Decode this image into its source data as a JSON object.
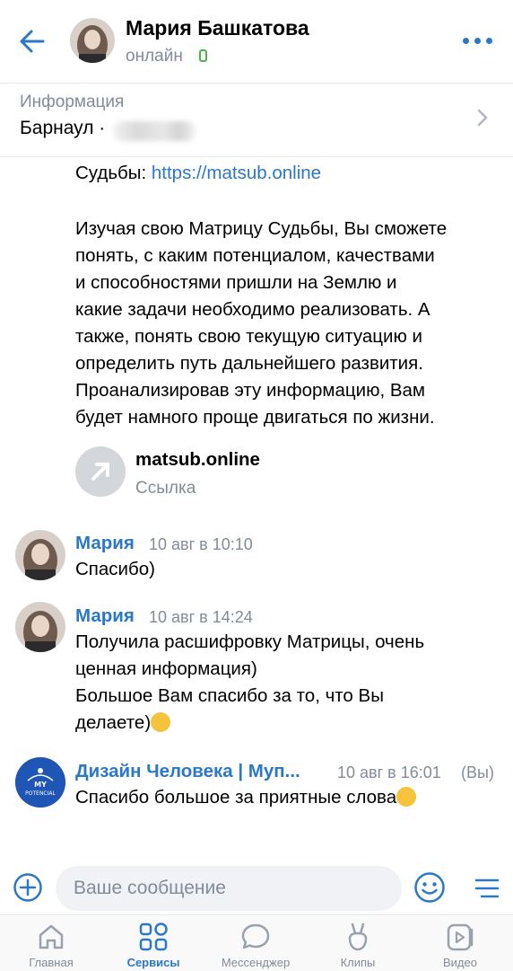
{
  "header": {
    "name": "Мария Башкатова",
    "status": "онлайн",
    "back_icon": "arrow-left-icon",
    "more_icon": "more-horizontal-icon"
  },
  "info": {
    "label": "Информация",
    "city": "Барнаул ·"
  },
  "message_top": {
    "line1_prefix": "Судьбы: ",
    "line1_link": "https://matsub.online",
    "paragraph": [
      "Изучая свою Матрицу Судьбы, Вы сможете",
      "понять, с каким потенциалом, качествами",
      "и способностями пришли на Землю и",
      "какие задачи необходимо реализовать. А",
      "также, понять свою текущую ситуацию и",
      "определить путь дальнейшего развития.",
      "Проанализировав эту информацию, Вам",
      "будет намного проще двигаться по жизни."
    ],
    "link_card": {
      "title": "matsub.online",
      "subtitle": "Ссылка"
    }
  },
  "messages": [
    {
      "sender": "Мария",
      "time": "10 авг в 10:10",
      "lines": [
        "Спасибо)"
      ]
    },
    {
      "sender": "Мария",
      "time": "10 авг в 14:24",
      "lines": [
        "Получила расшифровку Матрицы, очень",
        "ценная информация)",
        "Большое Вам спасибо за то, что Вы",
        "делаете)"
      ]
    },
    {
      "sender": "Дизайн Человека | Myп...",
      "time": "10 авг в 16:01",
      "you": "(Вы)",
      "lines": [
        "Спасибо большое за приятные слова"
      ],
      "avatar_text": [
        "MY",
        "POTENCIAL"
      ]
    }
  ],
  "composer": {
    "placeholder": "Ваше сообщение"
  },
  "tabs": [
    {
      "label": "Главная",
      "icon": "home-icon",
      "active": false
    },
    {
      "label": "Сервисы",
      "icon": "services-grid-icon",
      "active": true
    },
    {
      "label": "Мессенджер",
      "icon": "message-bubble-icon",
      "active": false
    },
    {
      "label": "Клипы",
      "icon": "clips-icon",
      "active": false
    },
    {
      "label": "Видео",
      "icon": "video-play-icon",
      "active": false
    }
  ],
  "colors": {
    "accent": "#2a78c8",
    "secondary_text": "#818c99",
    "online": "#4bb34b"
  }
}
